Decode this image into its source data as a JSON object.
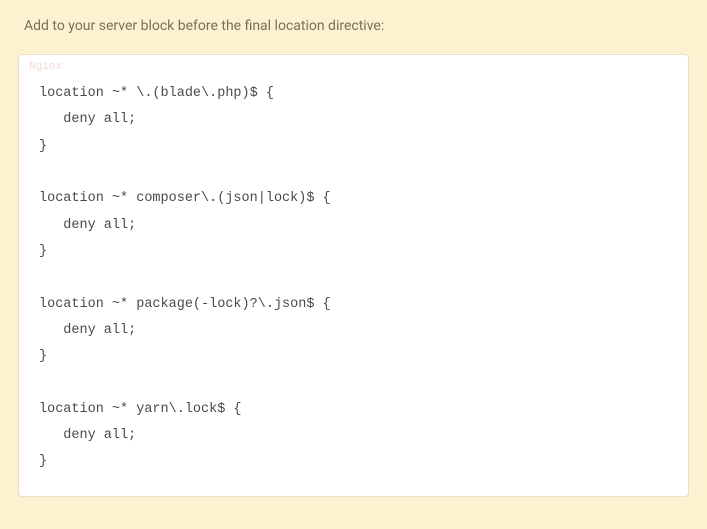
{
  "instruction": "Add to your server block before the final location directive:",
  "code": {
    "language": "Nginx",
    "content": "location ~* \\.(blade\\.php)$ {\n   deny all;\n}\n\nlocation ~* composer\\.(json|lock)$ {\n   deny all;\n}\n\nlocation ~* package(-lock)?\\.json$ {\n   deny all;\n}\n\nlocation ~* yarn\\.lock$ {\n   deny all;\n}"
  }
}
